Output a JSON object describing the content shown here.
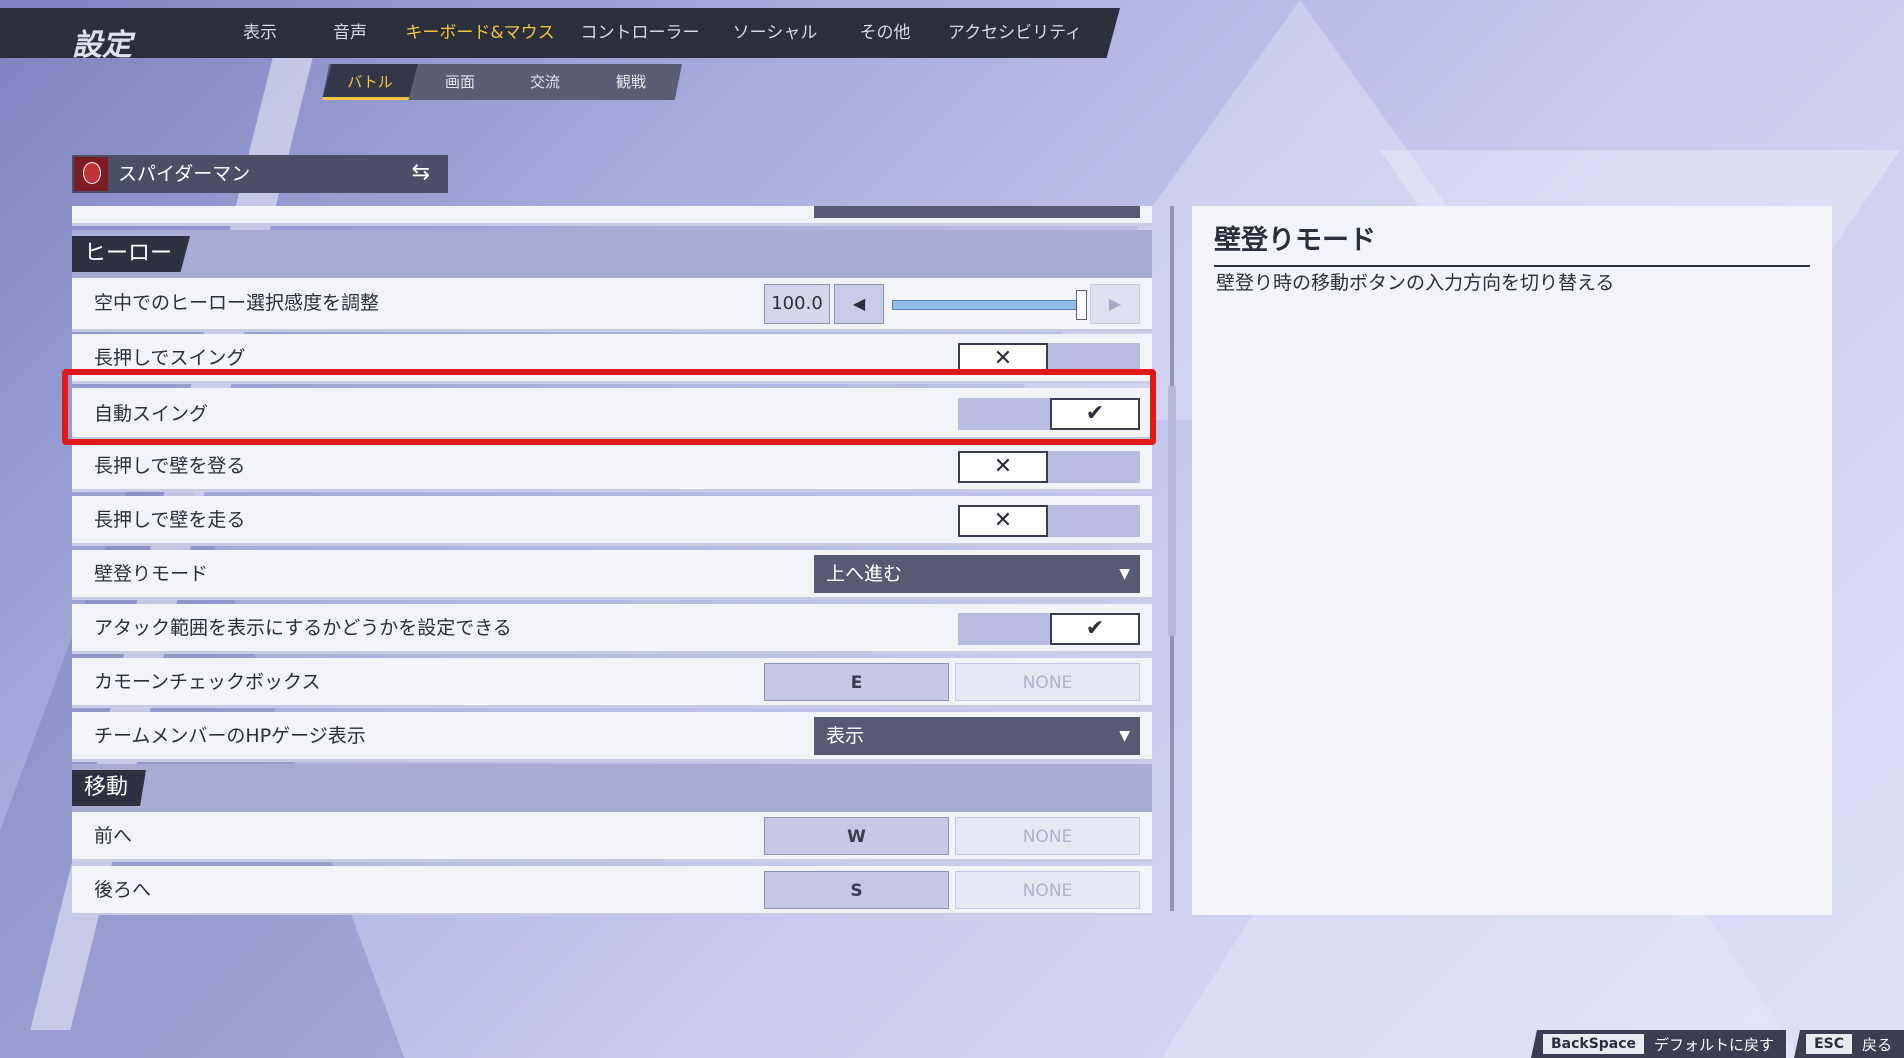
{
  "title": "設定",
  "tabs": [
    "表示",
    "音声",
    "キーボード&マウス",
    "コントローラー",
    "ソーシャル",
    "その他",
    "アクセシビリティ"
  ],
  "active_tab": "キーボード&マウス",
  "subtabs": [
    "バトル",
    "画面",
    "交流",
    "観戦"
  ],
  "active_subtab": "バトル",
  "hero": {
    "name": "スパイダーマン"
  },
  "sections": {
    "hero": "ヒーロー",
    "move": "移動"
  },
  "rows": {
    "air_sensitivity": {
      "label": "空中でのヒーロー選択感度を調整",
      "value": "100.0",
      "fraction": 1.0
    },
    "hold_swing": {
      "label": "長押しでスイング",
      "state": "off"
    },
    "auto_swing": {
      "label": "自動スイング",
      "state": "on"
    },
    "hold_climb": {
      "label": "長押しで壁を登る",
      "state": "off"
    },
    "hold_run": {
      "label": "長押しで壁を走る",
      "state": "off"
    },
    "climb_mode": {
      "label": "壁登りモード",
      "value": "上へ進む"
    },
    "attack_range": {
      "label": "アタック範囲を表示にするかどうかを設定できる",
      "state": "on"
    },
    "camo_checkbox": {
      "label": "カモーンチェックボックス",
      "primary": "E",
      "secondary": "NONE"
    },
    "team_hp": {
      "label": "チームメンバーのHPゲージ表示",
      "value": "表示"
    },
    "forward": {
      "label": "前へ",
      "primary": "W",
      "secondary": "NONE"
    },
    "backward": {
      "label": "後ろへ",
      "primary": "S",
      "secondary": "NONE"
    }
  },
  "description": {
    "title": "壁登りモード",
    "text": "壁登り時の移動ボタンの入力方向を切り替える"
  },
  "footer": [
    {
      "key": "BackSpace",
      "label": "デフォルトに戻す"
    },
    {
      "key": "ESC",
      "label": "戻る"
    }
  ],
  "icons": {
    "check": "check-icon",
    "cross": "cross-icon",
    "swap": "swap-icon",
    "dropdown": "triangle-down-icon"
  },
  "colors": {
    "accent": "#f2c53d",
    "highlight": "#e01919"
  }
}
